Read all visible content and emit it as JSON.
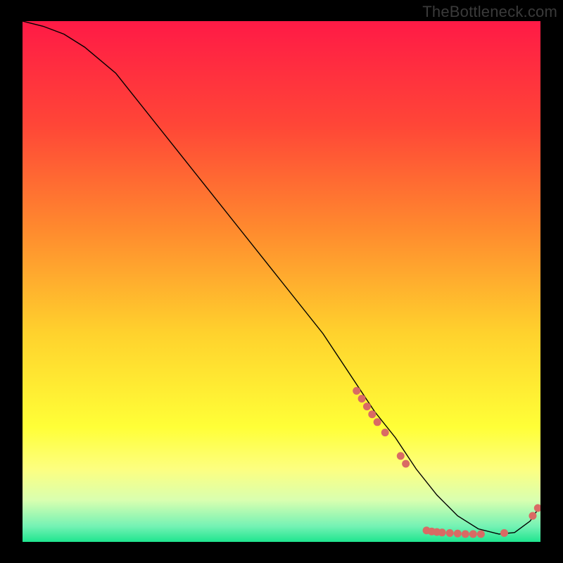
{
  "watermark": "TheBottleneck.com",
  "chart_data": {
    "type": "line",
    "title": "",
    "xlabel": "",
    "ylabel": "",
    "xlim": [
      0,
      100
    ],
    "ylim": [
      0,
      100
    ],
    "grid": false,
    "legend": false,
    "background_gradient": {
      "stops": [
        {
          "offset": 0.0,
          "color": "#ff1a46"
        },
        {
          "offset": 0.2,
          "color": "#ff4637"
        },
        {
          "offset": 0.4,
          "color": "#ff8a2e"
        },
        {
          "offset": 0.6,
          "color": "#ffd22d"
        },
        {
          "offset": 0.78,
          "color": "#ffff37"
        },
        {
          "offset": 0.86,
          "color": "#fdff80"
        },
        {
          "offset": 0.92,
          "color": "#d9ffb0"
        },
        {
          "offset": 0.97,
          "color": "#74f2b4"
        },
        {
          "offset": 1.0,
          "color": "#1fe58f"
        }
      ]
    },
    "series": [
      {
        "name": "bottleneck-curve",
        "color": "#000000",
        "stroke_width": 1.4,
        "x": [
          0,
          4,
          8,
          12,
          18,
          26,
          34,
          42,
          50,
          58,
          64,
          68,
          72,
          76,
          80,
          84,
          88,
          92,
          95,
          98,
          100
        ],
        "values": [
          100,
          99,
          97.5,
          95,
          90,
          80,
          70,
          60,
          50,
          40,
          31,
          25,
          20,
          14,
          9,
          5,
          2.5,
          1.5,
          1.8,
          4,
          7
        ]
      }
    ],
    "points": {
      "name": "curve-markers",
      "color": "#d96a64",
      "radius": 5.5,
      "data": [
        {
          "x": 64.5,
          "y": 29.0
        },
        {
          "x": 65.5,
          "y": 27.5
        },
        {
          "x": 66.5,
          "y": 26.0
        },
        {
          "x": 67.5,
          "y": 24.5
        },
        {
          "x": 68.5,
          "y": 23.0
        },
        {
          "x": 70.0,
          "y": 21.0
        },
        {
          "x": 73.0,
          "y": 16.5
        },
        {
          "x": 74.0,
          "y": 15.0
        },
        {
          "x": 78.0,
          "y": 2.2
        },
        {
          "x": 79.0,
          "y": 2.0
        },
        {
          "x": 80.0,
          "y": 1.9
        },
        {
          "x": 81.0,
          "y": 1.8
        },
        {
          "x": 82.5,
          "y": 1.7
        },
        {
          "x": 84.0,
          "y": 1.6
        },
        {
          "x": 85.5,
          "y": 1.5
        },
        {
          "x": 87.0,
          "y": 1.5
        },
        {
          "x": 88.5,
          "y": 1.5
        },
        {
          "x": 93.0,
          "y": 1.7
        },
        {
          "x": 98.5,
          "y": 5.0
        },
        {
          "x": 99.5,
          "y": 6.5
        }
      ]
    }
  }
}
